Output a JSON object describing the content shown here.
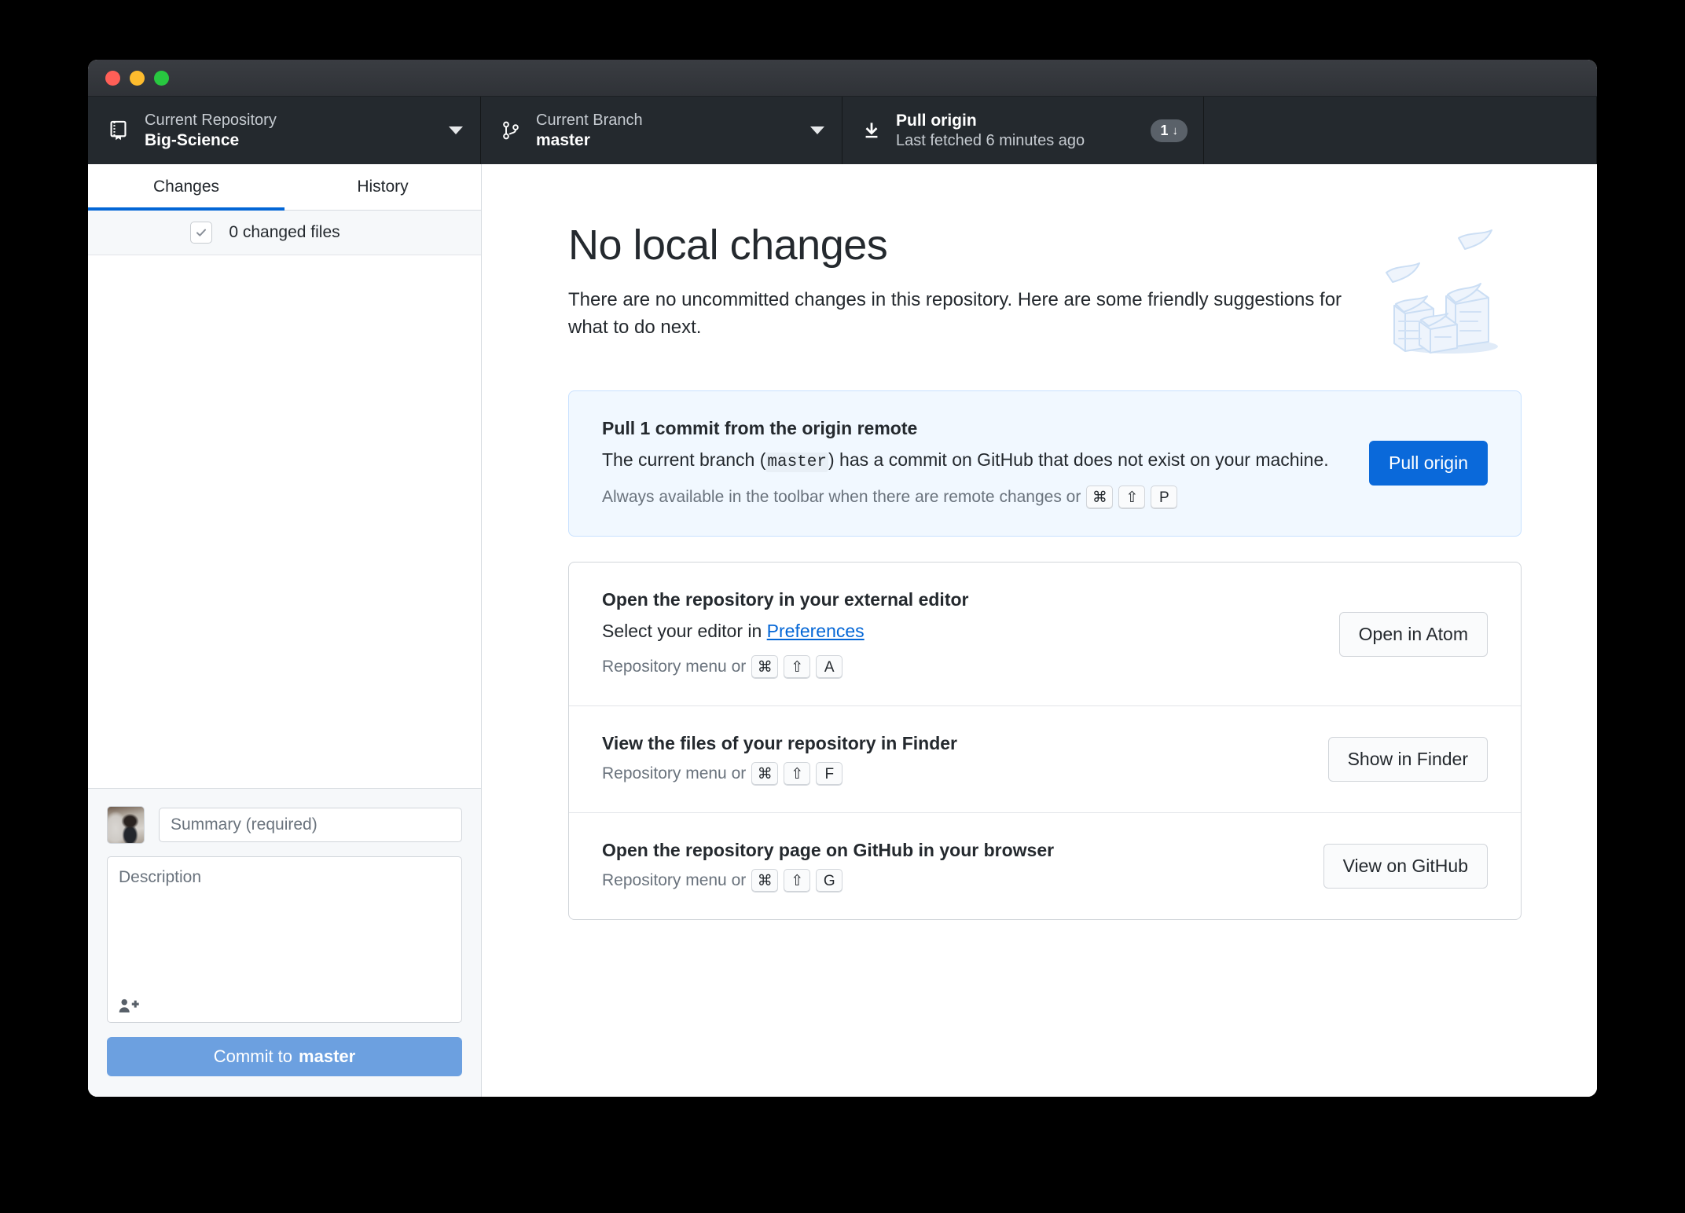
{
  "window": {
    "traffic_lights": [
      "close",
      "minimize",
      "zoom"
    ],
    "colors": {
      "close": "#ff5f57",
      "minimize": "#febc2e",
      "zoom": "#28c840",
      "toolbar_bg": "#24292e",
      "accent": "#0366d6",
      "primary_button": "#0a69da",
      "commit_button": "#6ca0e0",
      "info_card_bg": "#f1f8ff"
    }
  },
  "toolbar": {
    "repository": {
      "label": "Current Repository",
      "value": "Big-Science",
      "icon": "repo-icon"
    },
    "branch": {
      "label": "Current Branch",
      "value": "master",
      "icon": "git-branch-icon"
    },
    "pull": {
      "title": "Pull origin",
      "subtitle": "Last fetched 6 minutes ago",
      "badge_count": "1",
      "badge_arrow": "↓",
      "icon": "arrow-down-icon"
    }
  },
  "sidebar": {
    "tabs": [
      {
        "label": "Changes",
        "active": true
      },
      {
        "label": "History",
        "active": false
      }
    ],
    "files_header": {
      "count_label": "0 changed files",
      "checkbox_state": "checked"
    },
    "commit_form": {
      "summary_placeholder": "Summary (required)",
      "summary_value": "",
      "description_placeholder": "Description",
      "description_value": "",
      "coauthor_icon": "add-coauthor-icon",
      "commit_button_prefix": "Commit to ",
      "commit_button_branch": "master"
    }
  },
  "main": {
    "headline": "No local changes",
    "subtext": "There are no uncommitted changes in this repository. Here are some friendly suggestions for what to do next.",
    "illustration": "paper-stack-illustration",
    "pull_card": {
      "title": "Pull 1 commit from the origin remote",
      "desc_part1": "The current branch (",
      "desc_branch": "master",
      "desc_part2": ") has a commit on GitHub that does not exist on your machine.",
      "hint_text": "Always available in the toolbar when there are remote changes or",
      "hint_keys": [
        "⌘",
        "⇧",
        "P"
      ],
      "button": "Pull origin"
    },
    "suggestions": [
      {
        "title": "Open the repository in your external editor",
        "desc_prefix": "Select your editor in ",
        "desc_link": "Preferences",
        "hint_text": "Repository menu or",
        "hint_keys": [
          "⌘",
          "⇧",
          "A"
        ],
        "button": "Open in Atom"
      },
      {
        "title": "View the files of your repository in Finder",
        "desc_prefix": "",
        "desc_link": "",
        "hint_text": "Repository menu or",
        "hint_keys": [
          "⌘",
          "⇧",
          "F"
        ],
        "button": "Show in Finder"
      },
      {
        "title": "Open the repository page on GitHub in your browser",
        "desc_prefix": "",
        "desc_link": "",
        "hint_text": "Repository menu or",
        "hint_keys": [
          "⌘",
          "⇧",
          "G"
        ],
        "button": "View on GitHub"
      }
    ]
  }
}
